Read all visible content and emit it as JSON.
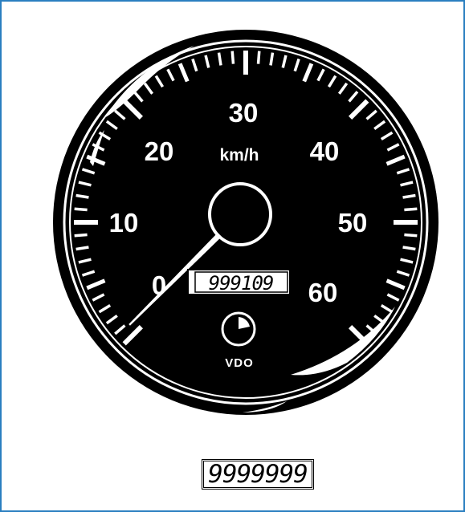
{
  "gauge": {
    "unit": "km/h",
    "brand": "VDO",
    "min": 0,
    "max": 60,
    "major_labels": [
      "0",
      "10",
      "20",
      "30",
      "40",
      "50",
      "60"
    ],
    "needle_value": 0,
    "odometer_reading": "999109",
    "colors": {
      "face": "#000000",
      "markings": "#ffffff",
      "frame": "#2a7fc0"
    }
  },
  "counter": {
    "display_value": "9999999"
  }
}
